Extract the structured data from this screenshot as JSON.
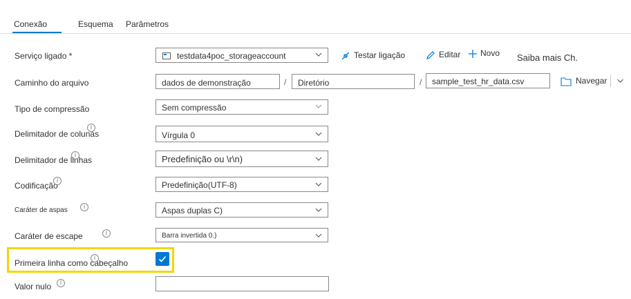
{
  "tabs": [
    {
      "label": "Conexão",
      "active": true
    },
    {
      "label": "Esquema",
      "active": false
    },
    {
      "label": "Parâmetros",
      "active": false
    }
  ],
  "linked_service": {
    "label": "Serviço ligado",
    "required_mark": "*",
    "value": "testdata4poc_storageaccount",
    "test_label": "Testar ligação",
    "edit_label": "Editar",
    "new_label": "Novo",
    "learn_more": "Saiba mais Ch."
  },
  "file_path": {
    "label": "Caminho do arquivo",
    "container": "dados de demonstração",
    "directory": "Diretório",
    "file": "sample_test_hr_data.csv",
    "separator": "/",
    "browse_label": "Navegar"
  },
  "compression": {
    "label": "Tipo de compressão",
    "value": "Sem compressão"
  },
  "column_delimiter": {
    "label": "Delimitador de colunas",
    "value": "Vírgula 0"
  },
  "row_delimiter": {
    "label": "Delimitador de linhas",
    "value": "Predefinição ou \\r\\n)"
  },
  "encoding": {
    "label": "Codificação",
    "value": "Predefinição(UTF-8)"
  },
  "quote_char": {
    "label": "Caráter de aspas",
    "value": "Aspas duplas C)"
  },
  "escape_char": {
    "label": "Caráter de escape",
    "value": "Barra invertida 0.)"
  },
  "first_row_header": {
    "label": "Primeira linha como cabeçalho",
    "checked": true
  },
  "null_value": {
    "label": "Valor nulo",
    "value": ""
  },
  "info_glyph": "i",
  "colors": {
    "accent": "#0078d4",
    "highlight": "#f2d600"
  }
}
